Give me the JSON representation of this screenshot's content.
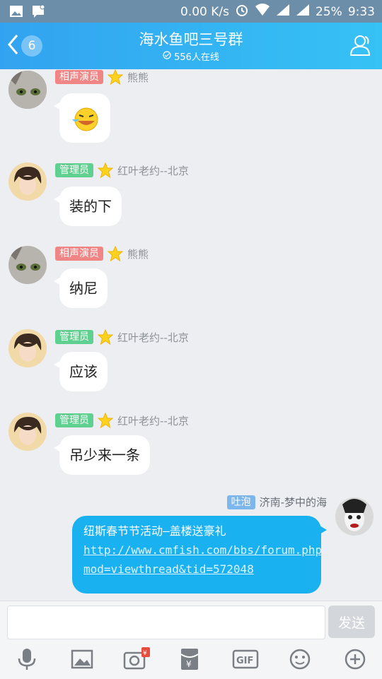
{
  "status_bar": {
    "speed": "0.00 K/s",
    "battery": "25%",
    "time": "9:33"
  },
  "header": {
    "back_count": "6",
    "title": "海水鱼吧三号群",
    "online": "556人在线"
  },
  "messages": [
    {
      "tag": "相声演员",
      "name": "熊熊",
      "text": "",
      "emoji": "crying-laughing-emoji"
    },
    {
      "tag": "管理员",
      "name": "红叶老约--北京",
      "text": "装的下"
    },
    {
      "tag": "相声演员",
      "name": "熊熊",
      "text": "纳尼"
    },
    {
      "tag": "管理员",
      "name": "红叶老约--北京",
      "text": "应该"
    },
    {
      "tag": "管理员",
      "name": "红叶老约--北京",
      "text": "吊少来一条"
    }
  ],
  "self_message": {
    "tag": "吐泡",
    "name": "济南-梦中的海",
    "text_prefix": "纽斯春节节活动—盖楼送豪礼 ",
    "link": "http://www.cmfish.com/bbs/forum.php?mod=viewthread&tid=572048"
  },
  "input": {
    "send_label": "发送"
  },
  "watermark": "cmfish.com",
  "colors": {
    "header": "#32a3f0",
    "bubble_self": "#19b1f0",
    "tag_red": "#f08585",
    "tag_green": "#5fd08f"
  }
}
